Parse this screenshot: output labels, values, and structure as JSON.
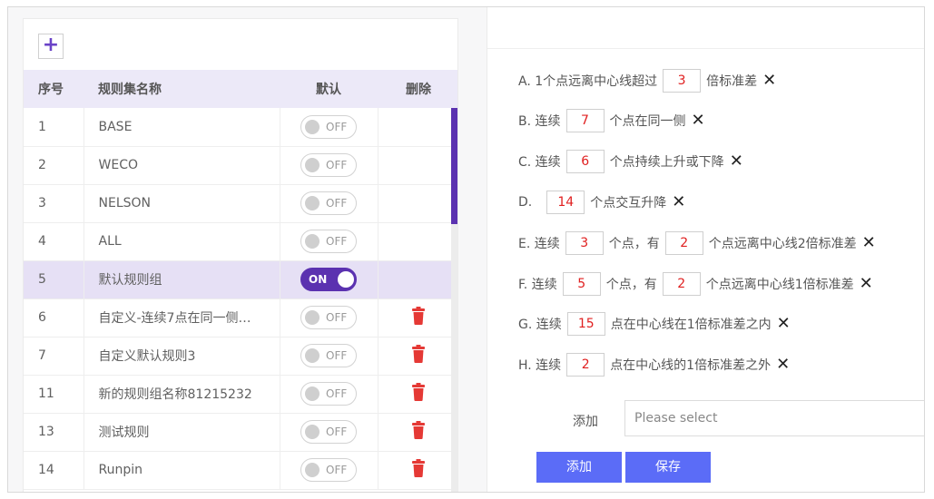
{
  "left_panel": {
    "add_icon": "+",
    "headers": {
      "index": "序号",
      "name": "规则集名称",
      "default": "默认",
      "delete": "删除"
    },
    "rows": [
      {
        "index": "1",
        "name": "BASE",
        "toggle": "OFF",
        "on": false,
        "deletable": false
      },
      {
        "index": "2",
        "name": "WECO",
        "toggle": "OFF",
        "on": false,
        "deletable": false
      },
      {
        "index": "3",
        "name": "NELSON",
        "toggle": "OFF",
        "on": false,
        "deletable": false
      },
      {
        "index": "4",
        "name": "ALL",
        "toggle": "OFF",
        "on": false,
        "deletable": false
      },
      {
        "index": "5",
        "name": "默认规则组",
        "toggle": "ON",
        "on": true,
        "deletable": false
      },
      {
        "index": "6",
        "name": "自定义-连续7点在同一侧…",
        "toggle": "OFF",
        "on": false,
        "deletable": true
      },
      {
        "index": "7",
        "name": "自定义默认规则3",
        "toggle": "OFF",
        "on": false,
        "deletable": true
      },
      {
        "index": "11",
        "name": "新的规则组名称81215232",
        "toggle": "OFF",
        "on": false,
        "deletable": true
      },
      {
        "index": "13",
        "name": "测试规则",
        "toggle": "OFF",
        "on": false,
        "deletable": true
      },
      {
        "index": "14",
        "name": "Runpin",
        "toggle": "OFF",
        "on": false,
        "deletable": true
      }
    ],
    "accent_color": "#5b32b0",
    "delete_color": "#e53935"
  },
  "rules": {
    "a": {
      "p1": "A. 1个点远离中心线超过",
      "v1": "3",
      "p2": "倍标准差"
    },
    "b": {
      "p1": "B. 连续",
      "v1": "7",
      "p2": "个点在同一侧"
    },
    "c": {
      "p1": "C. 连续",
      "v1": "6",
      "p2": "个点持续上升或下降"
    },
    "d": {
      "p1": "D.",
      "v1": "14",
      "p2": "个点交互升降"
    },
    "e": {
      "p1": "E. 连续",
      "v1": "3",
      "p2": "个点，有",
      "v2": "2",
      "p3": "个点远离中心线2倍标准差"
    },
    "f": {
      "p1": "F. 连续",
      "v1": "5",
      "p2": "个点，有",
      "v2": "2",
      "p3": "个点远离中心线1倍标准差"
    },
    "g": {
      "p1": "G. 连续",
      "v1": "15",
      "p2": "点在中心线在1倍标准差之内"
    },
    "h": {
      "p1": "H. 连续",
      "v1": "2",
      "p2": "点在中心线的1倍标准差之外"
    },
    "remove_icon": "✕"
  },
  "add_form": {
    "label": "添加",
    "placeholder": "Please select",
    "add_button": "添加",
    "save_button": "保存",
    "button_color": "#5b6cf7"
  }
}
